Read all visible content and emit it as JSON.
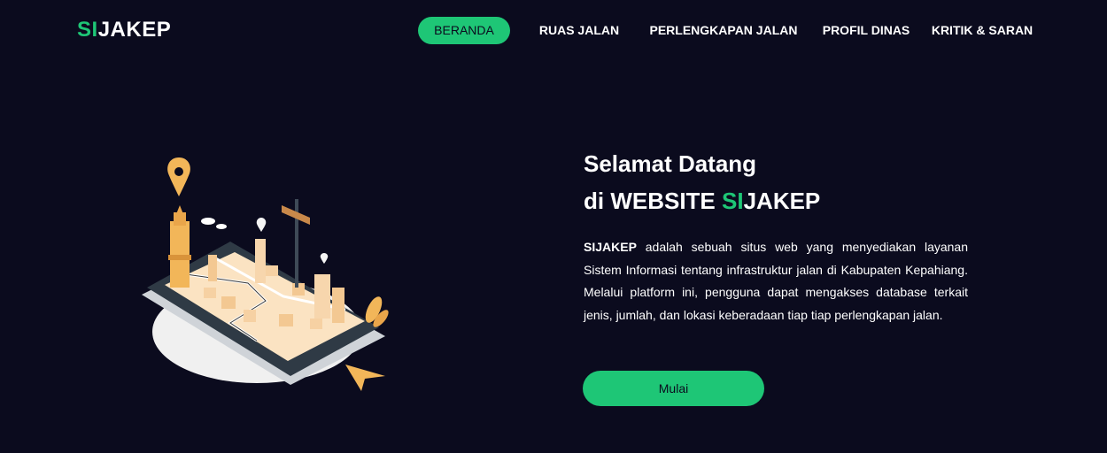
{
  "brand": {
    "logo_accent": "SI",
    "logo_rest": "JAKEP",
    "accent_color": "#1ec676",
    "background_color": "#0b0b1e"
  },
  "nav": {
    "items": [
      {
        "label": "BERANDA",
        "active": true
      },
      {
        "label": "RUAS JALAN",
        "active": false
      },
      {
        "label": "PERLENGKAPAN JALAN",
        "active": false
      },
      {
        "label": "PROFIL DINAS",
        "active": false
      },
      {
        "label": "KRITIK & SARAN",
        "active": false
      }
    ]
  },
  "hero": {
    "title_line1": "Selamat Datang",
    "title_line2_prefix": "di WEBSITE ",
    "title_line2_accent": "SI",
    "title_line2_rest": "JAKEP",
    "description_bold": "SIJAKEP",
    "description_rest": " adalah sebuah situs web yang menyediakan layanan Sistem Informasi tentang infrastruktur jalan di Kabupaten Kepahiang. Melalui platform ini, pengguna dapat mengakses database terkait jenis, jumlah, dan lokasi keberadaan tiap tiap perlengkapan jalan.",
    "cta_label": "Mulai",
    "illustration": "isometric-city-map-phone-illustration"
  }
}
